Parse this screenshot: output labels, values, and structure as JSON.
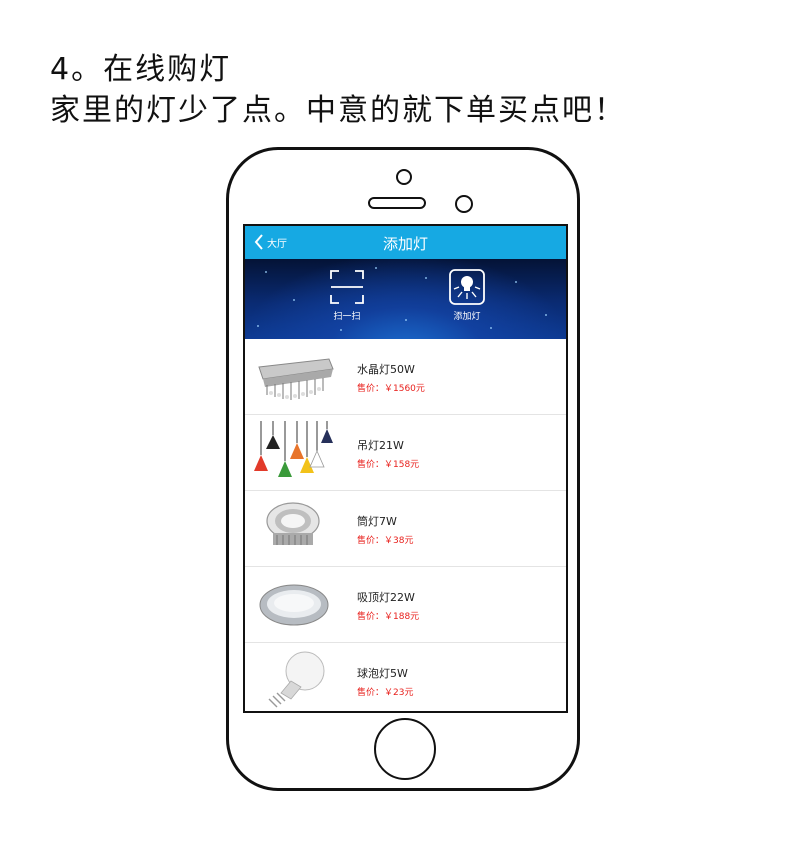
{
  "heading": {
    "line1": "4。在线购灯",
    "line2": "家里的灯少了点。中意的就下单买点吧！"
  },
  "app": {
    "back_label": "大厅",
    "title": "添加灯",
    "accent_color": "#16a9e3",
    "price_color": "#e8201c"
  },
  "banner": {
    "scan_label": "扫一扫",
    "add_label": "添加灯"
  },
  "products": [
    {
      "name": "水晶灯50W",
      "price": "售价：￥1560元",
      "icon": "crystal-chandelier"
    },
    {
      "name": "吊灯21W",
      "price": "售价：￥158元",
      "icon": "pendant-lamps"
    },
    {
      "name": "筒灯7W",
      "price": "售价：￥38元",
      "icon": "downlight"
    },
    {
      "name": "吸顶灯22W",
      "price": "售价：￥188元",
      "icon": "ceiling-lamp"
    },
    {
      "name": "球泡灯5W",
      "price": "售价：￥23元",
      "icon": "led-bulb"
    }
  ]
}
